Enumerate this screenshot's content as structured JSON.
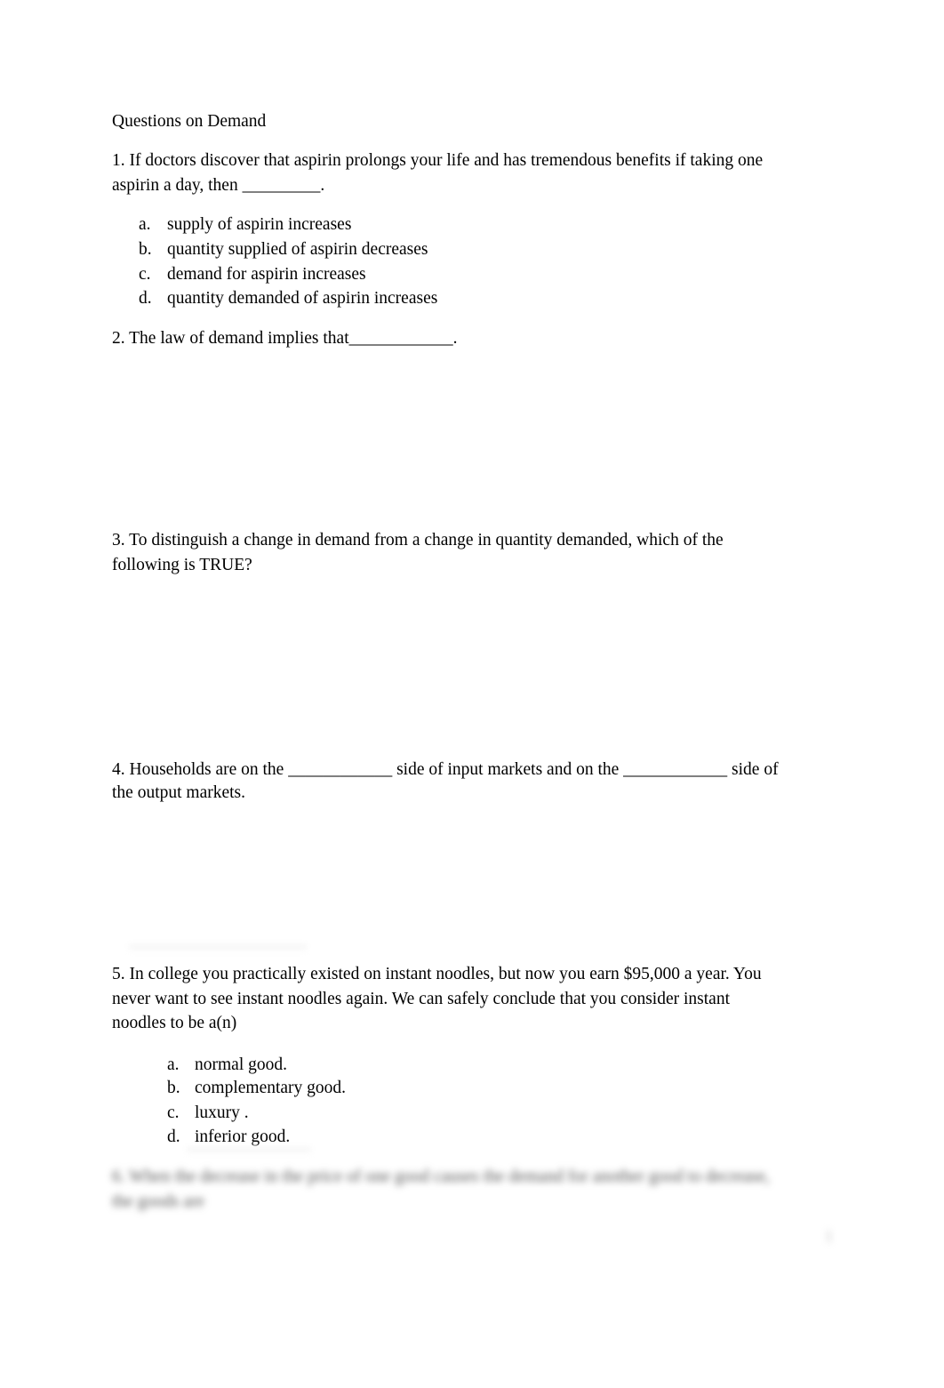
{
  "document": {
    "title": "Questions on Demand",
    "questions": [
      {
        "line1": "1. If doctors discover that aspirin prolongs your life and has tremendous benefits if taking one",
        "line2": "aspirin a day, then _________.",
        "options": [
          {
            "label": "a.",
            "text": "supply of aspirin increases"
          },
          {
            "label": "b.",
            "text": "quantity supplied of aspirin decreases"
          },
          {
            "label": "c.",
            "text": "demand for aspirin increases"
          },
          {
            "label": "d.",
            "text": "quantity demanded of aspirin increases"
          }
        ]
      },
      {
        "line1": "2. The law of demand implies that____________."
      },
      {
        "line1": "3. To distinguish a change in demand from a change in quantity demanded, which of the",
        "line2": "following is TRUE?"
      },
      {
        "line1": "4. Households are on the ____________ side of input markets and on the ____________ side of",
        "line2": "the output markets."
      },
      {
        "line1": "5. In college you practically existed on instant noodles, but now you earn $95,000 a year.  You",
        "line2": "never want to see instant noodles again.  We can safely conclude that you consider instant",
        "line3": "noodles to be a(n)",
        "options": [
          {
            "label": "a.",
            "text": "normal good."
          },
          {
            "label": "b.",
            "text": "complementary good."
          },
          {
            "label": "c.",
            "text": "luxury ."
          },
          {
            "label": "d.",
            "text": "inferior good."
          }
        ]
      }
    ],
    "blurred_preview": {
      "line1": "6. When the decrease in the price of one good causes the demand for another good to decrease,",
      "line2": "the goods are",
      "page_number": "1"
    }
  }
}
